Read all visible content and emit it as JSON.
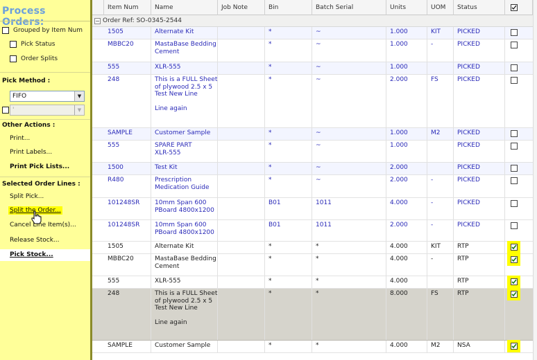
{
  "sidebar": {
    "title": "Process Orders:",
    "grouped_by_item_num": "Grouped by Item Num",
    "pick_status": "Pick Status",
    "order_splits": "Order Splits",
    "pick_method_heading": "Pick Method :",
    "pick_method_value": "FIFO",
    "second_select_value": "'",
    "other_actions_heading": "Other Actions :",
    "print": "Print...",
    "print_labels": "Print Labels...",
    "print_pick_lists": "Print Pick Lists...",
    "selected_order_lines_heading": "Selected Order Lines :",
    "split_pick": "Split Pick...",
    "split_the_order": "Split the Order...",
    "cancel_line_items": "Cancel Line Item(s)...",
    "release_stock": "Release Stock...",
    "pick_stock": "Pick Stock..."
  },
  "grid": {
    "columns": [
      "Item Num",
      "Name",
      "Job Note",
      "Bin",
      "Batch Serial",
      "Units",
      "UOM",
      "Status"
    ],
    "group_label": "Order Ref: SO-0345-2544",
    "rows": [
      {
        "item": "1505",
        "name": [
          "Alternate Kit"
        ],
        "bin": "*",
        "batch": "~",
        "units": "1.000",
        "uom": "KIT",
        "status": "PICKED"
      },
      {
        "item": "MBBC20",
        "name": [
          "MastaBase Bedding",
          "Cement"
        ],
        "bin": "*",
        "batch": "~",
        "units": "1.000",
        "uom": "-",
        "status": "PICKED"
      },
      {
        "item": "555",
        "name": [
          "XLR-555"
        ],
        "bin": "*",
        "batch": "~",
        "units": "1.000",
        "uom": "",
        "status": "PICKED"
      },
      {
        "item": "248",
        "name": [
          "This is a FULL Sheet",
          "of plywood 2.5 x 5",
          "Test New Line",
          "",
          "Line again"
        ],
        "bin": "*",
        "batch": "~",
        "units": "2.000",
        "uom": "FS",
        "status": "PICKED"
      },
      {
        "item": "SAMPLE",
        "name": [
          "Customer Sample"
        ],
        "bin": "*",
        "batch": "~",
        "units": "1.000",
        "uom": "M2",
        "status": "PICKED"
      },
      {
        "item": "555",
        "name": [
          "SPARE PART",
          "XLR-555"
        ],
        "bin": "*",
        "batch": "~",
        "units": "1.000",
        "uom": "",
        "status": "PICKED"
      },
      {
        "item": "1500",
        "name": [
          "Test Kit"
        ],
        "bin": "*",
        "batch": "~",
        "units": "2.000",
        "uom": "",
        "status": "PICKED"
      },
      {
        "item": "R480",
        "name": [
          "Prescription",
          "Medication Guide"
        ],
        "bin": "*",
        "batch": "~",
        "units": "2.000",
        "uom": "-",
        "status": "PICKED"
      },
      {
        "item": "101248SR",
        "name": [
          "10mm Span 600",
          "PBoard 4800x1200"
        ],
        "bin": "B01",
        "batch": "1011",
        "units": "4.000",
        "uom": "-",
        "status": "PICKED"
      },
      {
        "item": "101248SR",
        "name": [
          "10mm Span 600",
          "PBoard 4800x1200"
        ],
        "bin": "B01",
        "batch": "1011",
        "units": "2.000",
        "uom": "-",
        "status": "PICKED"
      },
      {
        "item": "1505",
        "name": [
          "Alternate Kit"
        ],
        "bin": "*",
        "batch": "*",
        "units": "4.000",
        "uom": "KIT",
        "status": "RTP"
      },
      {
        "item": "MBBC20",
        "name": [
          "MastaBase Bedding",
          "Cement"
        ],
        "bin": "*",
        "batch": "*",
        "units": "4.000",
        "uom": "-",
        "status": "RTP"
      },
      {
        "item": "555",
        "name": [
          "XLR-555"
        ],
        "bin": "*",
        "batch": "*",
        "units": "4.000",
        "uom": "",
        "status": "RTP"
      },
      {
        "item": "248",
        "name": [
          "This is a FULL Sheet",
          "of plywood 2.5 x 5",
          "Test New Line",
          "",
          "Line again"
        ],
        "bin": "*",
        "batch": "*",
        "units": "8.000",
        "uom": "FS",
        "status": "RTP"
      },
      {
        "item": "SAMPLE",
        "name": [
          "Customer Sample"
        ],
        "bin": "*",
        "batch": "*",
        "units": "4.000",
        "uom": "M2",
        "status": "NSA"
      }
    ]
  }
}
